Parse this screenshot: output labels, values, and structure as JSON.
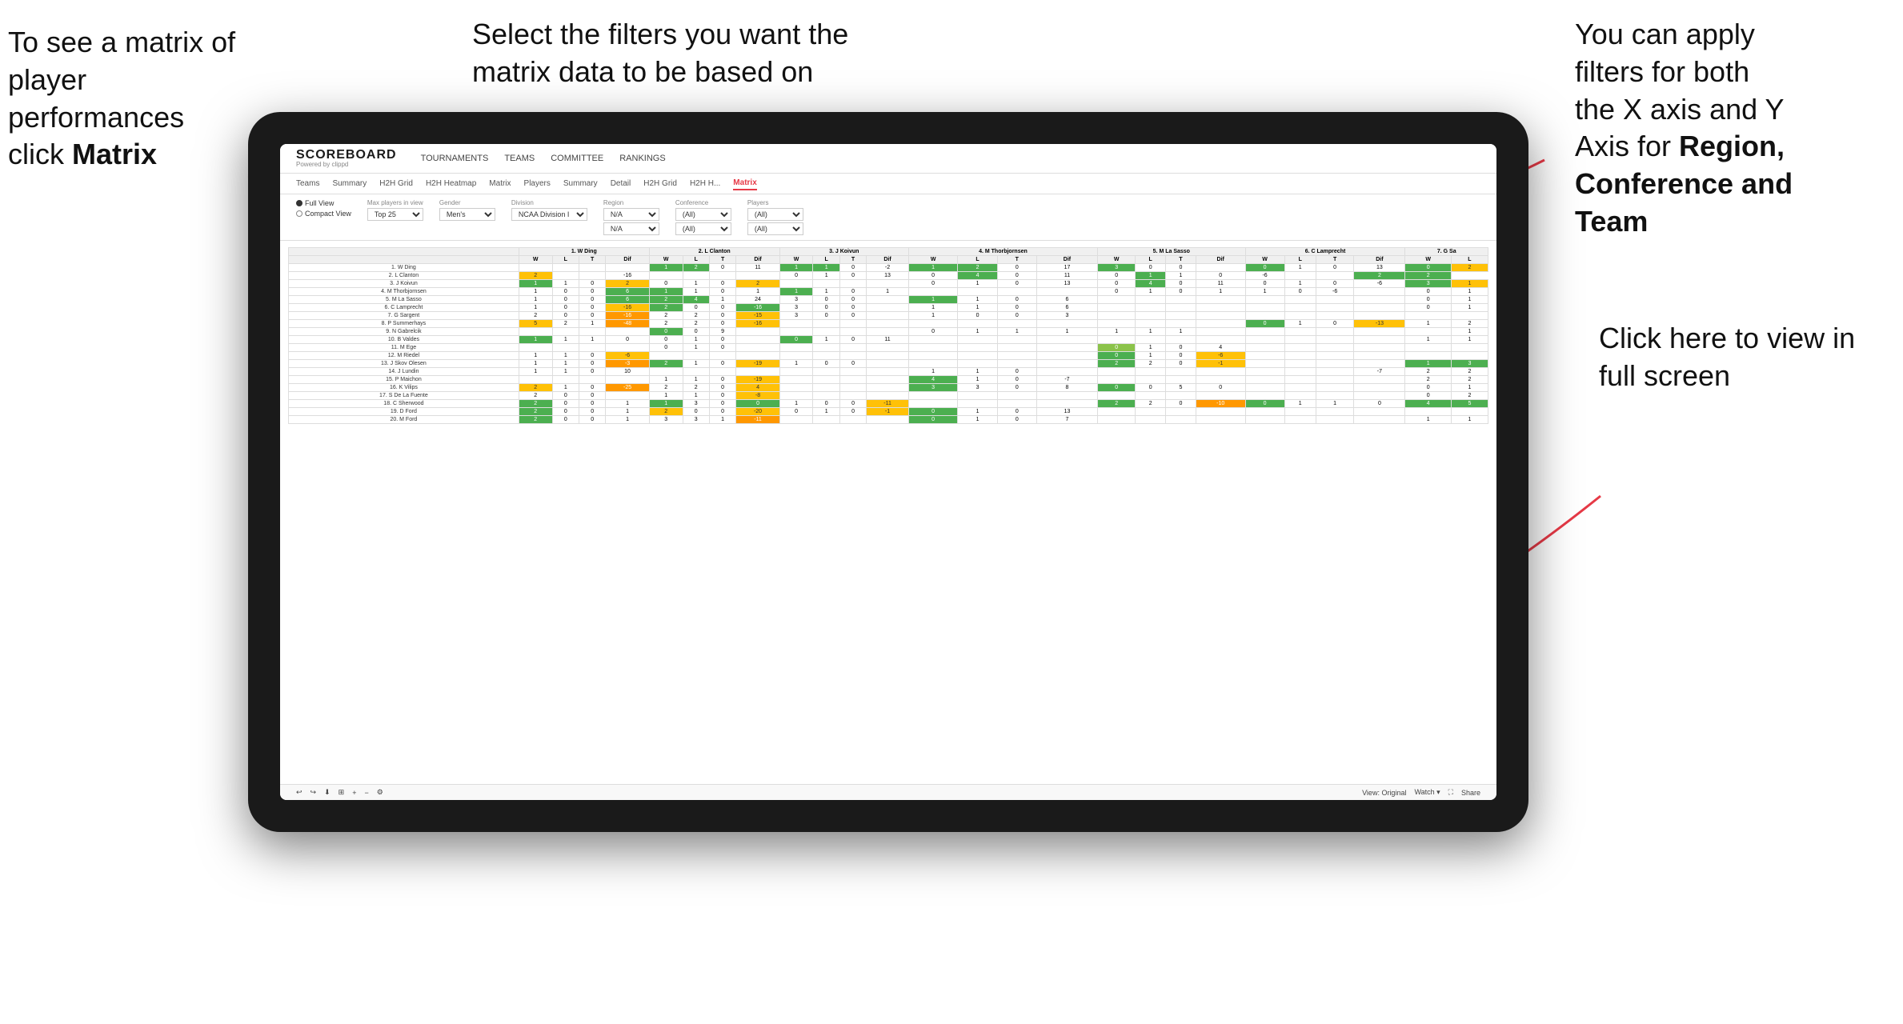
{
  "annotations": {
    "left": {
      "line1": "To see a matrix of",
      "line2": "player performances",
      "line3_prefix": "click ",
      "line3_bold": "Matrix"
    },
    "center": {
      "text": "Select the filters you want the matrix data to be based on"
    },
    "right": {
      "line1": "You  can apply",
      "line2": "filters for both",
      "line3": "the X axis and Y",
      "line4_prefix": "Axis for ",
      "line4_bold": "Region,",
      "line5_bold": "Conference and",
      "line6_bold": "Team"
    },
    "bottom_right": {
      "text": "Click here to view in full screen"
    }
  },
  "nav": {
    "logo": "SCOREBOARD",
    "powered": "Powered by clippd",
    "items": [
      "TOURNAMENTS",
      "TEAMS",
      "COMMITTEE",
      "RANKINGS"
    ]
  },
  "sub_nav": {
    "items": [
      "Teams",
      "Summary",
      "H2H Grid",
      "H2H Heatmap",
      "Matrix",
      "Players",
      "Summary",
      "Detail",
      "H2H Grid",
      "H2H H...",
      "Matrix"
    ],
    "active": "Matrix"
  },
  "filters": {
    "view": {
      "full": "Full View",
      "compact": "Compact View",
      "selected": "full"
    },
    "max_players": {
      "label": "Max players in view",
      "value": "Top 25"
    },
    "gender": {
      "label": "Gender",
      "value": "Men's"
    },
    "division": {
      "label": "Division",
      "value": "NCAA Division I"
    },
    "region": {
      "label": "Region",
      "value1": "N/A",
      "value2": "N/A"
    },
    "conference": {
      "label": "Conference",
      "value1": "(All)",
      "value2": "(All)"
    },
    "players": {
      "label": "Players",
      "value1": "(All)",
      "value2": "(All)"
    }
  },
  "players": [
    "1. W Ding",
    "2. L Clanton",
    "3. J Koivun",
    "4. M Thorbjornsen",
    "5. M La Sasso",
    "6. C Lamprecht",
    "7. G Sargent",
    "8. P Summerhays",
    "9. N Gabrelcik",
    "10. B Valdes",
    "11. M Ege",
    "12. M Riedel",
    "13. J Skov Olesen",
    "14. J Lundin",
    "15. P Maichon",
    "16. K Vilips",
    "17. S De La Fuente",
    "18. C Sherwood",
    "19. D Ford",
    "20. M Ford"
  ],
  "column_headers": [
    "1. W Ding",
    "2. L Clanton",
    "3. J Koivun",
    "4. M Thorbjornsen",
    "5. M La Sasso",
    "6. C Lamprecht",
    "7. G Sa"
  ],
  "sub_headers": [
    "W",
    "L",
    "T",
    "Dif"
  ],
  "toolbar": {
    "view_label": "View: Original",
    "watch_label": "Watch ▾",
    "share_label": "Share"
  }
}
